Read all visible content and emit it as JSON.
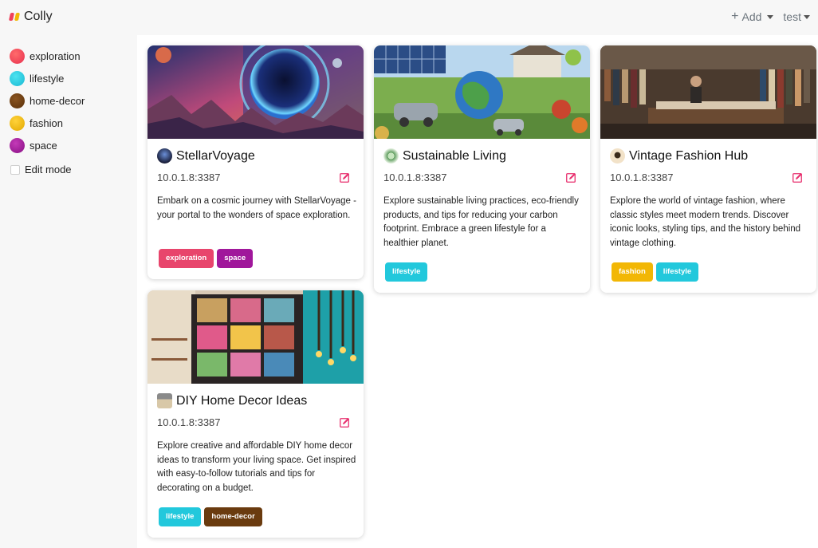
{
  "app": {
    "title": "Colly"
  },
  "topbar": {
    "add_label": "Add",
    "user_label": "test"
  },
  "sidebar": {
    "categories": [
      {
        "label": "exploration",
        "color": "#f0405a"
      },
      {
        "label": "lifestyle",
        "color": "#22c8dc"
      },
      {
        "label": "home-decor",
        "color": "#6a3b0f"
      },
      {
        "label": "fashion",
        "color": "#f2b705"
      },
      {
        "label": "space",
        "color": "#a0179b"
      }
    ],
    "edit_mode_label": "Edit mode"
  },
  "cards": [
    {
      "title": "StellarVoyage",
      "host": "10.0.1.8:3387",
      "description": "Embark on a cosmic journey with StellarVoyage - your portal to the wonders of space exploration.",
      "tags": [
        {
          "label": "exploration",
          "color": "#e8456c"
        },
        {
          "label": "space",
          "color": "#a0179b"
        }
      ]
    },
    {
      "title": "Sustainable Living",
      "host": "10.0.1.8:3387",
      "description": "Explore sustainable living practices, eco-friendly products, and tips for reducing your carbon footprint. Embrace a green lifestyle for a healthier planet.",
      "tags": [
        {
          "label": "lifestyle",
          "color": "#22c8dc"
        }
      ]
    },
    {
      "title": "Vintage Fashion Hub",
      "host": "10.0.1.8:3387",
      "description": "Explore the world of vintage fashion, where classic styles meet modern trends. Discover iconic looks, styling tips, and the history behind vintage clothing.",
      "tags": [
        {
          "label": "fashion",
          "color": "#f2b705"
        },
        {
          "label": "lifestyle",
          "color": "#22c8dc"
        }
      ]
    },
    {
      "title": "DIY Home Decor Ideas",
      "host": "10.0.1.8:3387",
      "description": "Explore creative and affordable DIY home decor ideas to transform your living space. Get inspired with easy-to-follow tutorials and tips for decorating on a budget.",
      "tags": [
        {
          "label": "lifestyle",
          "color": "#22c8dc"
        },
        {
          "label": "home-decor",
          "color": "#6a3b0f"
        }
      ]
    }
  ]
}
